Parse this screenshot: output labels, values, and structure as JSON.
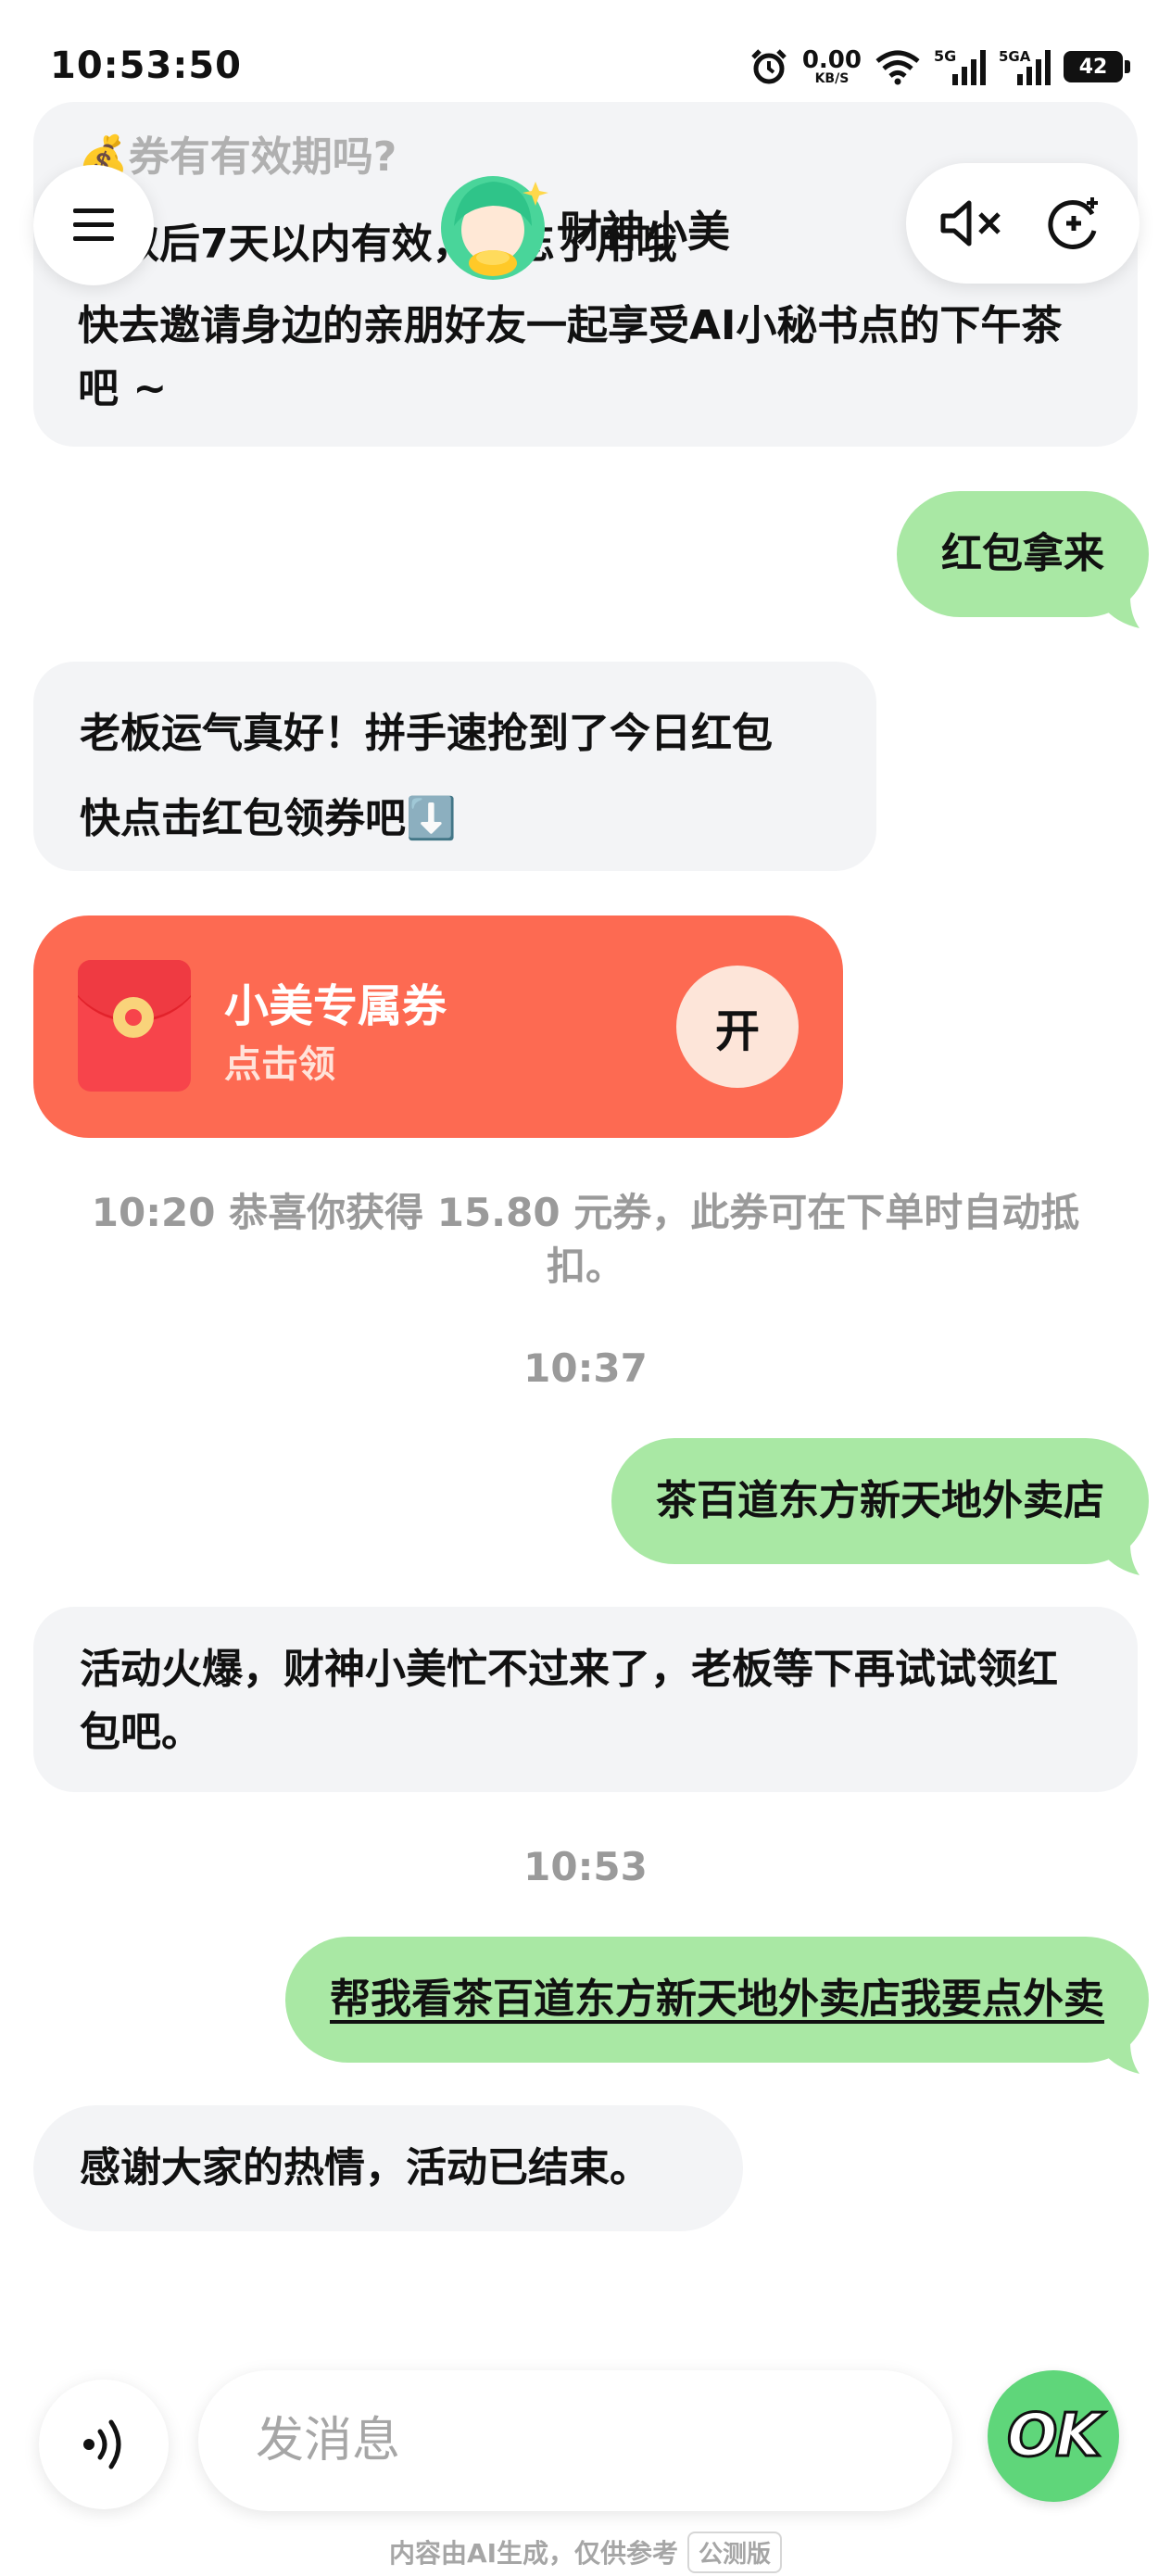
{
  "status": {
    "time": "10:53:50",
    "net_speed": "0.00",
    "net_unit": "KB/S",
    "signal1": "5G",
    "signal2": "5GA",
    "battery": "42"
  },
  "header": {
    "title": "财神小美",
    "menu_icon": "hamburger-icon",
    "mute_icon": "speaker-muted-icon",
    "new_chat_icon": "new-chat-icon"
  },
  "messages": {
    "top_card": {
      "line1": "💰券有有效期吗?",
      "line2": "领取后7天以内有效，别忘了用哦",
      "line3": "快去邀请身边的亲朋好友一起享受AI小秘书点的下午茶吧 ~"
    },
    "user1": "红包拿来",
    "bot1_line1": "老板运气真好！拼手速抢到了今日红包",
    "bot1_line2": "快点击红包领券吧⬇️",
    "coupon": {
      "title": "小美专属券",
      "subtitle": "点击领",
      "open_label": "开"
    },
    "system1": "10:20 恭喜你获得 15.80 元券，此券可在下单时自动抵扣。",
    "time1": "10:37",
    "user2": "茶百道东方新天地外卖店",
    "bot2": "活动火爆，财神小美忙不过来了，老板等下再试试领红包吧。",
    "time2": "10:53",
    "user3": "帮我看茶百道东方新天地外卖店我要点外卖",
    "bot3": "感谢大家的热情，活动已结束。"
  },
  "input": {
    "placeholder": "发消息",
    "send_label": "OK"
  },
  "footer": {
    "disclaimer": "内容由AI生成，仅供参考",
    "beta": "公测版"
  },
  "colors": {
    "user_bubble": "#a9e8a4",
    "bot_bubble": "#f3f4f6",
    "coupon": "#fd6a52",
    "accent": "#5fd67a"
  }
}
